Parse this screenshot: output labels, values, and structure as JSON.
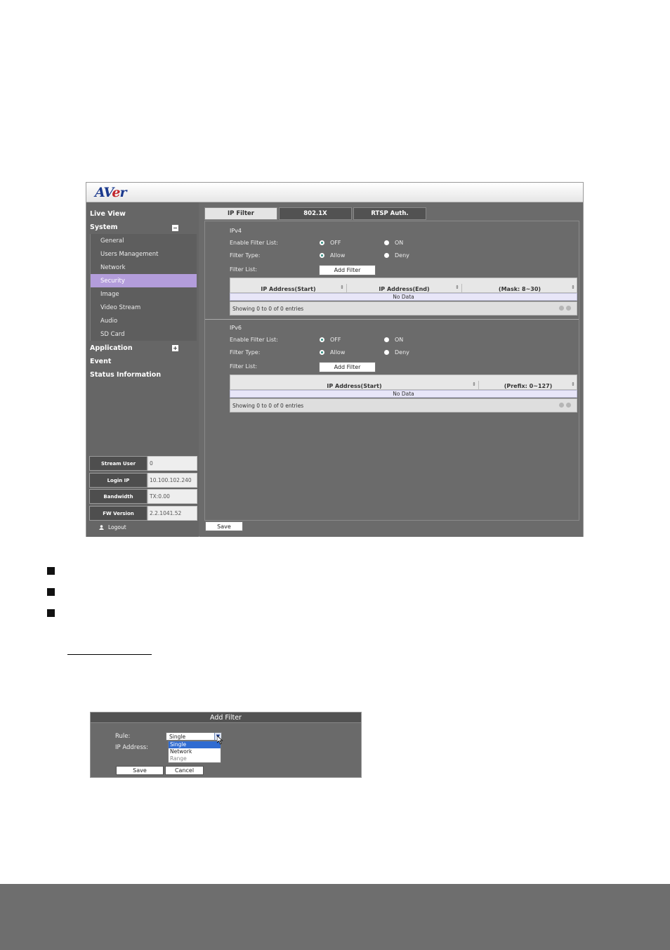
{
  "brand": {
    "logo_text_a": "AV",
    "logo_text_b": "e",
    "logo_text_c": "r"
  },
  "sidebar": {
    "live_view": "Live View",
    "system": "System",
    "system_toggle": "−",
    "system_items": [
      "General",
      "Users Management",
      "Network",
      "Security",
      "Image",
      "Video Stream",
      "Audio",
      "SD Card"
    ],
    "active_item": "Security",
    "application": "Application",
    "application_toggle": "+",
    "event": "Event",
    "status_information": "Status Information",
    "info": [
      {
        "label": "Stream User",
        "value": "0"
      },
      {
        "label": "Login IP",
        "value": "10.100.102.240"
      },
      {
        "label": "Bandwidth",
        "value": "TX:0.00"
      },
      {
        "label": "FW Version",
        "value": "2.2.1041.52"
      }
    ],
    "logout": "Logout"
  },
  "tabs": [
    "IP Filter",
    "802.1X",
    "RTSP Auth."
  ],
  "active_tab": "IP Filter",
  "ipv4": {
    "title": "IPv4",
    "enable_label": "Enable Filter List:",
    "enable_off": "OFF",
    "enable_on": "ON",
    "enable_value": "OFF",
    "type_label": "Filter Type:",
    "type_allow": "Allow",
    "type_deny": "Deny",
    "type_value": "Allow",
    "list_label": "Filter List:",
    "add_button": "Add Filter",
    "columns": [
      "IP Address(Start)",
      "IP Address(End)",
      "(Mask: 8~30)"
    ],
    "no_data": "No Data",
    "footer": "Showing 0 to 0 of 0 entries"
  },
  "ipv6": {
    "title": "IPv6",
    "enable_label": "Enable Filter List:",
    "enable_off": "OFF",
    "enable_on": "ON",
    "enable_value": "OFF",
    "type_label": "Filter Type:",
    "type_allow": "Allow",
    "type_deny": "Deny",
    "type_value": "Allow",
    "list_label": "Filter List:",
    "add_button": "Add Filter",
    "columns": [
      "IP Address(Start)",
      "(Prefix: 0~127)"
    ],
    "no_data": "No Data",
    "footer": "Showing 0 to 0 of 0 entries"
  },
  "save_button": "Save",
  "dialog": {
    "title": "Add Filter",
    "rule_label": "Rule:",
    "ip_label": "IP Address:",
    "rule_value": "Single",
    "rule_options": [
      "Single",
      "Network",
      "Range"
    ],
    "save": "Save",
    "cancel": "Cancel"
  }
}
